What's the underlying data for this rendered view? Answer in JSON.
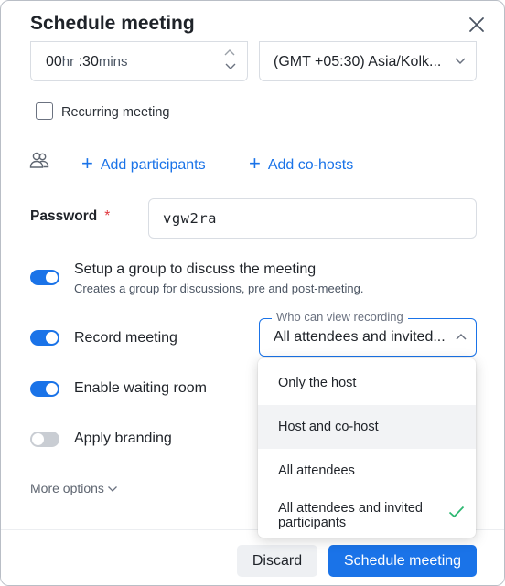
{
  "dialog": {
    "title": "Schedule meeting",
    "close_icon": "close-icon"
  },
  "duration": {
    "hours": "00",
    "hours_unit": "hr",
    "separator": ":",
    "minutes": "30",
    "minutes_unit": "mins"
  },
  "timezone": {
    "value": "(GMT +05:30) Asia/Kolk..."
  },
  "recurring": {
    "label": "Recurring meeting",
    "checked": false
  },
  "participants": {
    "icon": "people-icon",
    "add_participants": "Add participants",
    "add_cohosts": "Add co-hosts"
  },
  "password": {
    "label": "Password",
    "required_mark": "*",
    "value": "vgw2ra"
  },
  "options": {
    "group": {
      "label": "Setup a group to discuss the meeting",
      "sub": "Creates a group for discussions, pre and post-meeting.",
      "enabled": true
    },
    "record": {
      "label": "Record meeting",
      "enabled": true
    },
    "waiting_room": {
      "label": "Enable waiting room",
      "enabled": true
    },
    "branding": {
      "label": "Apply branding",
      "enabled": false
    }
  },
  "recording_access": {
    "legend": "Who can view recording",
    "selected": "All attendees and invited...",
    "options": [
      "Only the host",
      "Host and co-host",
      "All attendees",
      "All attendees and invited participants"
    ],
    "option_line1": "All attendees and invited",
    "option_line2": "participants"
  },
  "more_options": "More options",
  "footer": {
    "discard": "Discard",
    "schedule": "Schedule meeting"
  },
  "colors": {
    "accent": "#1a73e8",
    "required": "#e0383e",
    "check": "#2eb872"
  }
}
